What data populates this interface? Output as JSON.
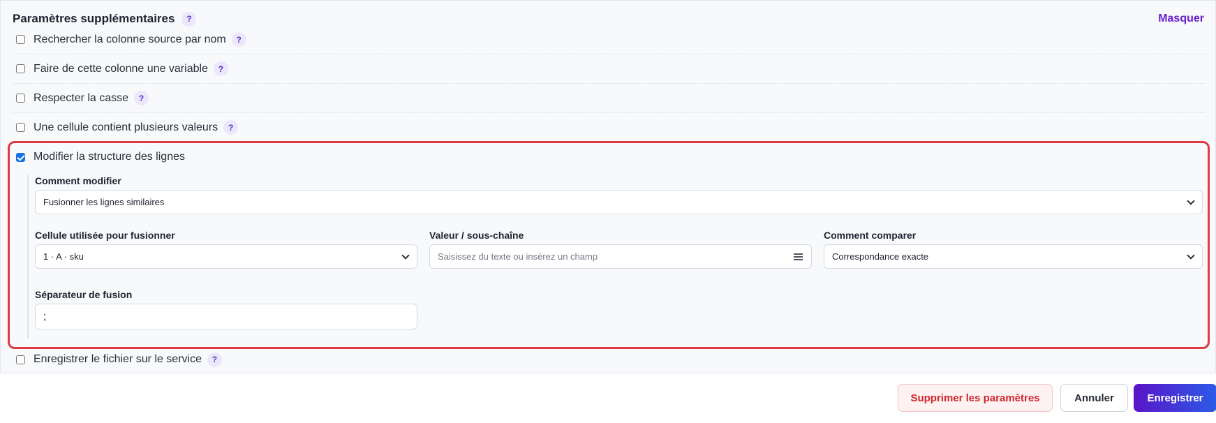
{
  "section": {
    "title": "Paramètres supplémentaires",
    "help": "?",
    "hide_label": "Masquer"
  },
  "options": [
    {
      "label": "Rechercher la colonne source par nom",
      "checked": false,
      "help": "?"
    },
    {
      "label": "Faire de cette colonne une variable",
      "checked": false,
      "help": "?"
    },
    {
      "label": "Respecter la casse",
      "checked": false,
      "help": "?"
    },
    {
      "label": "Une cellule contient plusieurs valeurs",
      "checked": false,
      "help": "?"
    },
    {
      "label": "Modifier la structure des lignes",
      "checked": true
    },
    {
      "label": "Enregistrer le fichier sur le service",
      "checked": false,
      "help": "?"
    }
  ],
  "structure": {
    "how_modify_label": "Comment modifier",
    "how_modify_value": "Fusionner les lignes similaires",
    "merge_cell_label": "Cellule utilisée pour fusionner",
    "merge_cell_value": "1 · A · sku",
    "value_label": "Valeur / sous-chaîne",
    "value_placeholder": "Saisissez du texte ou insérez un champ",
    "compare_label": "Comment comparer",
    "compare_value": "Correspondance exacte",
    "separator_label": "Séparateur de fusion",
    "separator_value": ";"
  },
  "footer": {
    "delete_label": "Supprimer les paramètres",
    "cancel_label": "Annuler",
    "save_label": "Enregistrer"
  },
  "colors": {
    "accent": "#6a1fd0",
    "highlight": "#dc3b42",
    "danger": "#d0262e"
  }
}
